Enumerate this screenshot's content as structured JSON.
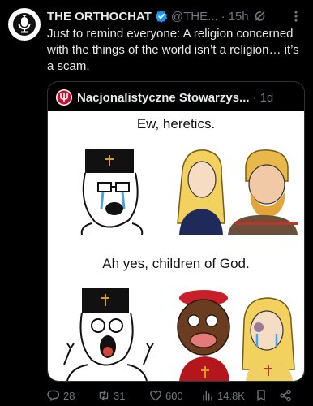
{
  "author": {
    "name": "THE ORTHOCHAT",
    "handle": "@THE...",
    "separator": "·",
    "time": "15h",
    "verified_color": "#1d9bf0"
  },
  "post": {
    "text": "Just to remind everyone: A religion concerned with the things of the world isn’t a religion… it’s a scam."
  },
  "quoted": {
    "name": "Nacjonalistyczne Stowarzys...",
    "separator": "·",
    "time": "1d",
    "meme": {
      "caption_top": "Ew, heretics.",
      "caption_bottom": "Ah yes, children of God."
    }
  },
  "actions": {
    "replies": "28",
    "reposts": "31",
    "likes": "600",
    "views": "14.8K"
  },
  "icons": [
    "microphone-icon",
    "verified-icon",
    "grok-icon",
    "more-icon",
    "emblem-icon",
    "reply-icon",
    "repost-icon",
    "like-icon",
    "views-icon",
    "bookmark-icon",
    "share-icon"
  ],
  "colors": {
    "background": "#000000",
    "text": "#e7e9ea",
    "muted": "#71767b",
    "border": "#2f3336",
    "accent": "#1d9bf0"
  }
}
